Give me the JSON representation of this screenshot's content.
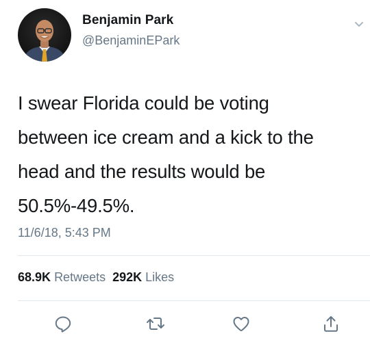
{
  "user": {
    "name": "Benjamin Park",
    "handle": "@BenjaminEPark"
  },
  "tweet": {
    "lines": [
      "I swear Florida could be voting",
      "between ice cream and a kick to the",
      "head and the results would be",
      "50.5%-49.5%."
    ],
    "timestamp": "11/6/18, 5:43 PM"
  },
  "stats": {
    "retweets_count": "68.9K",
    "retweets_label": "Retweets",
    "likes_count": "292K",
    "likes_label": "Likes"
  },
  "icons": {
    "reply": "reply-icon",
    "retweet": "retweet-icon",
    "like": "heart-icon",
    "share": "share-icon",
    "menu": "chevron-down-icon"
  },
  "colors": {
    "text": "#14171a",
    "secondary": "#657786",
    "divider": "#e1e8ed"
  }
}
